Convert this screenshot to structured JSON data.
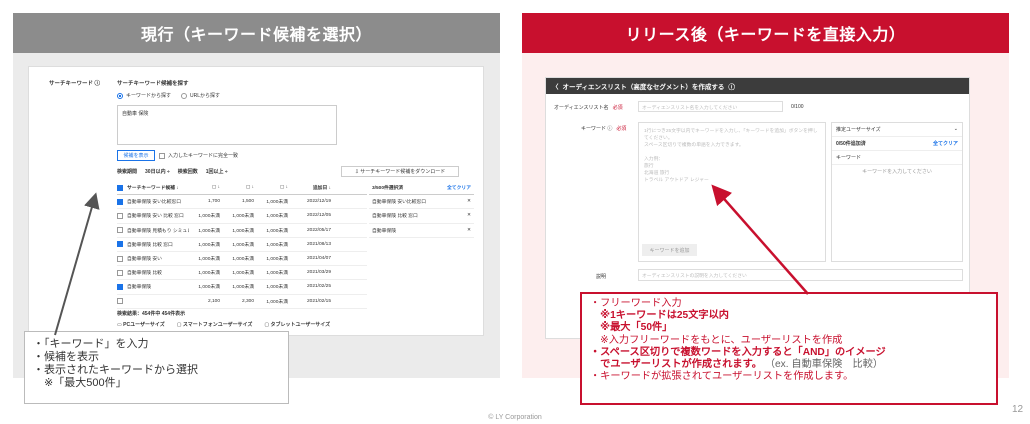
{
  "left": {
    "header": "現行（キーワード候補を選択）",
    "section_label": "サーチキーワード",
    "find_title": "サーチキーワード候補を探す",
    "radio_keyword": "キーワードから探す",
    "radio_url": "URLから探す",
    "keyword_input_value": "自動車 保険",
    "show_button": "候補を表示",
    "exact_match": "入力したキーワードに完全一致",
    "filter_period_label": "検索期間",
    "filter_period_value": "30日以内 ÷",
    "filter_count_label": "検索回数",
    "filter_count_value": "1回以上 ÷",
    "download_button": "サーチキーワード候補をダウンロード",
    "table_headers": [
      "サーチキーワード候補 ↓",
      "▢ ↓",
      "▢ ↓",
      "▢ ↓",
      "追加日 ↓"
    ],
    "rows": [
      {
        "checked": true,
        "kw": "自動車保険 安い比較窓口",
        "a": "1,700",
        "b": "1,500",
        "c": "1,000未満",
        "date": "2022/12/19"
      },
      {
        "checked": false,
        "kw": "自動車保険 安い 比較 窓口",
        "a": "1,000未満",
        "b": "1,000未満",
        "c": "1,000未満",
        "date": "2022/12/05"
      },
      {
        "checked": false,
        "kw": "自動車保険 見積もり シミュレーション",
        "a": "1,000未満",
        "b": "1,000未満",
        "c": "1,000未満",
        "date": "2022/05/17"
      },
      {
        "checked": true,
        "kw": "自動車保険 比較 窓口",
        "a": "1,000未満",
        "b": "1,000未満",
        "c": "1,000未満",
        "date": "2021/08/13"
      },
      {
        "checked": false,
        "kw": "自動車保険 安い",
        "a": "1,000未満",
        "b": "1,000未満",
        "c": "1,000未満",
        "date": "2021/04/07"
      },
      {
        "checked": false,
        "kw": "自動車保険 比較",
        "a": "1,000未満",
        "b": "1,000未満",
        "c": "1,000未満",
        "date": "2021/03/29"
      },
      {
        "checked": true,
        "kw": "自動車保険",
        "a": "1,000未満",
        "b": "1,000未満",
        "c": "1,000未満",
        "date": "2021/02/25"
      },
      {
        "checked": false,
        "kw": "",
        "a": "2,100",
        "b": "2,300",
        "c": "1,000未満",
        "date": "2021/02/15"
      }
    ],
    "selected_header": "3/500件選択済",
    "selected_clear": "全てクリア",
    "selected_items": [
      "自動車保険 安い比較窓口",
      "自動車保険 比較 窓口",
      "自動車保険"
    ],
    "results": "検索結果：454件中 454件表示",
    "devices": [
      "PCユーザーサイズ",
      "スマートフォンユーザーサイズ",
      "タブレットユーザーサイズ"
    ],
    "note_lines": [
      "・「キーワード」を入力",
      "・候補を表示",
      "・表示されたキーワードから選択",
      "　※「最大500件」"
    ]
  },
  "right": {
    "header": "リリース後（キーワードを直接入力）",
    "title_bar": "オーディエンスリスト（高度なセグメント）を作成する",
    "name_label": "オーディエンスリスト名",
    "required": "必須",
    "name_placeholder": "オーディエンスリスト名を入力してください",
    "name_count": "0/100",
    "keyword_label": "キーワード",
    "keyword_placeholder_lines": [
      "1行につき25文字以内でキーワードを入力し、「キーワードを追加」ボタンを押してください。",
      "スペース区切りで複数の単語を入力できます。",
      "",
      "入力例：",
      "旅行",
      "北海道 旅行",
      "トラベル アウトドア レジャー"
    ],
    "keyword_add_button": "キーワードを追加",
    "est_title": "推定ユーザーサイズ",
    "est_count": "0/50件追加済",
    "est_clear": "全てクリア",
    "est_keyword_header": "キーワード",
    "est_empty": "キーワードを入力してください",
    "desc_label": "説明",
    "desc_placeholder": "オーディエンスリストの説明を入力してください",
    "note": {
      "l1": "・フリーワード入力",
      "l2": "　※1キーワードは25文字以内",
      "l3": "　※最大「50件」",
      "l4": "　※入力フリーワードをもとに、ユーザーリストを作成",
      "l5": "・スペース区切りで複数ワードを入力すると「AND」のイメージ",
      "l6a": "　でユーザーリストが作成されます。",
      "l6b": "（ex. 自動車保険　比較）",
      "l7": "・キーワードが拡張されてユーザーリストを作成します。"
    }
  },
  "footer": "© LY Corporation",
  "page_number": "12",
  "colors": {
    "left_header": "#8c8c8c",
    "right_header": "#c8102e",
    "accent": "#1a73e8"
  }
}
